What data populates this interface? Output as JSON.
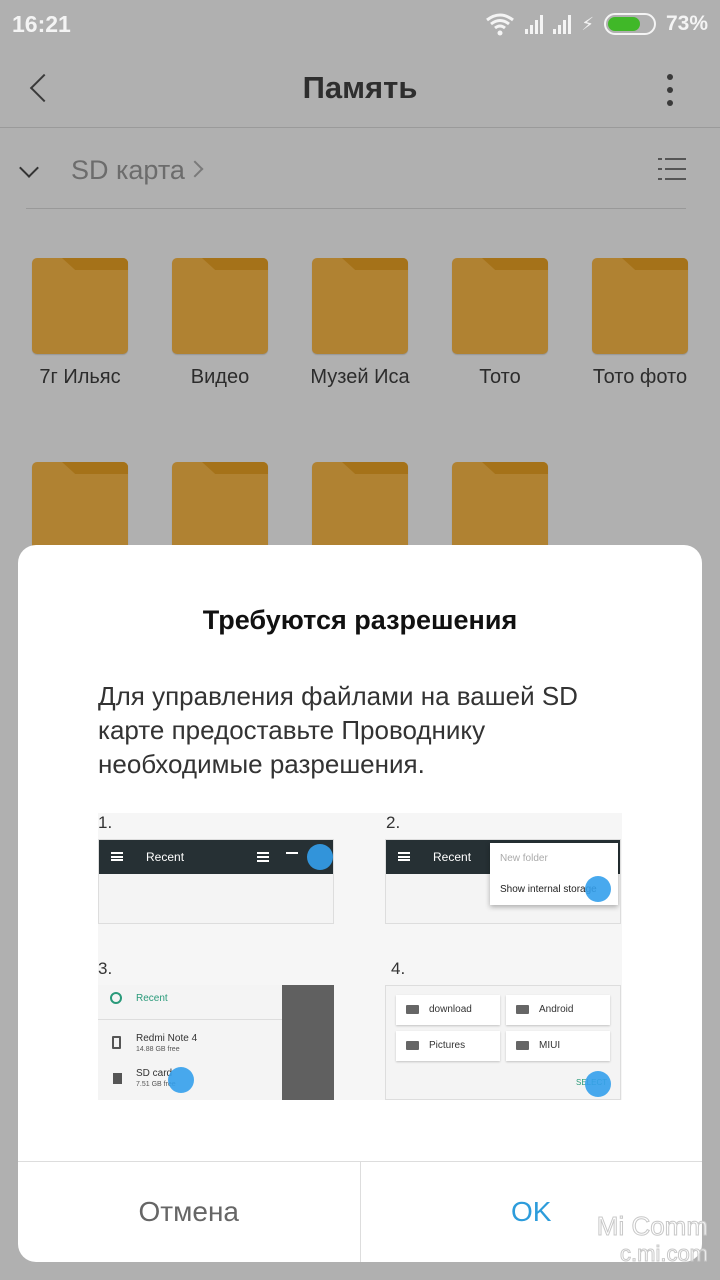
{
  "status_bar": {
    "time": "16:21",
    "battery_percent_label": "73%",
    "battery_level": 0.73,
    "battery_color": "#40b828",
    "icons": [
      "wifi-icon",
      "signal-icon",
      "signal-icon",
      "charging-icon",
      "battery-icon"
    ]
  },
  "app_bar": {
    "title": "Память",
    "back_icon": "chevron-left-icon",
    "menu_icon": "more-vertical-icon"
  },
  "path_bar": {
    "label": "SD карта",
    "expand_icon": "chevron-down-icon",
    "separator_icon": "chevron-right-icon",
    "view_toggle_icon": "list-view-icon"
  },
  "folders": [
    {
      "name": "7г Ильяс"
    },
    {
      "name": "Видео"
    },
    {
      "name": "Музей Иса"
    },
    {
      "name": "Тото"
    },
    {
      "name": "Тото фото"
    },
    {
      "name": ""
    },
    {
      "name": ""
    },
    {
      "name": ""
    },
    {
      "name": ""
    }
  ],
  "folder_color": "#b08232",
  "dialog": {
    "title": "Требуются разрешения",
    "message": "Для управления файлами на вашей SD карте предоставьте Проводнику необходимые разрешения.",
    "instructions": {
      "step1": {
        "number": "1.",
        "toolbar_title": "Recent"
      },
      "step2": {
        "number": "2.",
        "toolbar_title": "Recent",
        "menu_items": [
          "New folder",
          "Show internal storage"
        ]
      },
      "step3": {
        "number": "3.",
        "items": [
          {
            "label": "Recent",
            "sub": ""
          },
          {
            "label": "Redmi Note 4",
            "sub": "14.88 GB free"
          },
          {
            "label": "SD card",
            "sub": "7.51 GB free"
          }
        ]
      },
      "step4": {
        "number": "4.",
        "folders": [
          "download",
          "Android",
          "Pictures",
          "MIUI"
        ],
        "action": "SELECT"
      }
    },
    "cancel_label": "Отмена",
    "ok_label": "OK",
    "accent_color": "#2d9cdb"
  },
  "watermark": {
    "line1": "Mi Comm",
    "line2": "c.mi.com"
  }
}
